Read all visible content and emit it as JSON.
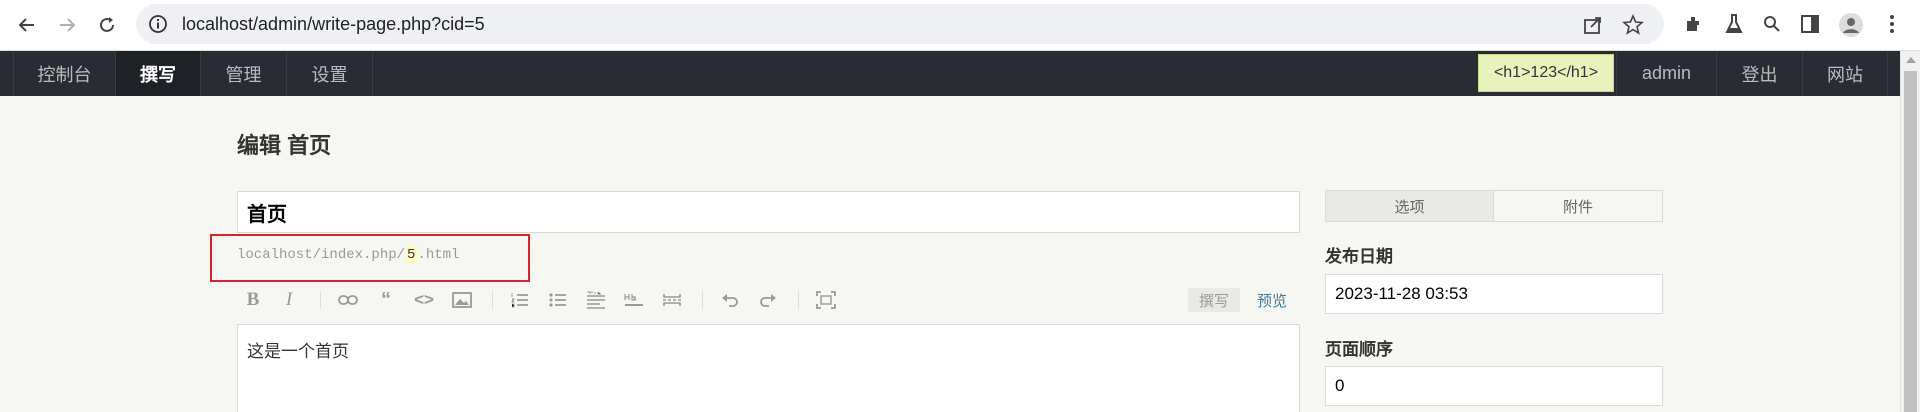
{
  "browser": {
    "url": "localhost/admin/write-page.php?cid=5"
  },
  "admin_nav": {
    "tabs": [
      {
        "label": "控制台"
      },
      {
        "label": "撰写"
      },
      {
        "label": "管理"
      },
      {
        "label": "设置"
      }
    ],
    "notice": "<h1>123</h1>",
    "user": "admin",
    "logout": "登出",
    "site": "网站"
  },
  "page": {
    "heading": "编辑 首页",
    "title_value": "首页",
    "permalink_prefix": "localhost/index.php/",
    "permalink_slug": "5",
    "permalink_suffix": ".html",
    "toolbar": {
      "bold": "B",
      "italic": "I",
      "write_mode": "撰写",
      "preview_mode": "预览"
    },
    "editor_content": "这是一个首页"
  },
  "sidebar": {
    "tabs": [
      {
        "label": "选项"
      },
      {
        "label": "附件"
      }
    ],
    "publish_date_label": "发布日期",
    "publish_date_value": "2023-11-28 03:53",
    "order_label": "页面顺序",
    "order_value": "0"
  },
  "colors": {
    "header_bg": "#292d33",
    "page_bg": "#f6f6f3",
    "link": "#467b96",
    "highlight_box": "#d9232a",
    "notice_bg": "#e9f2bd"
  }
}
